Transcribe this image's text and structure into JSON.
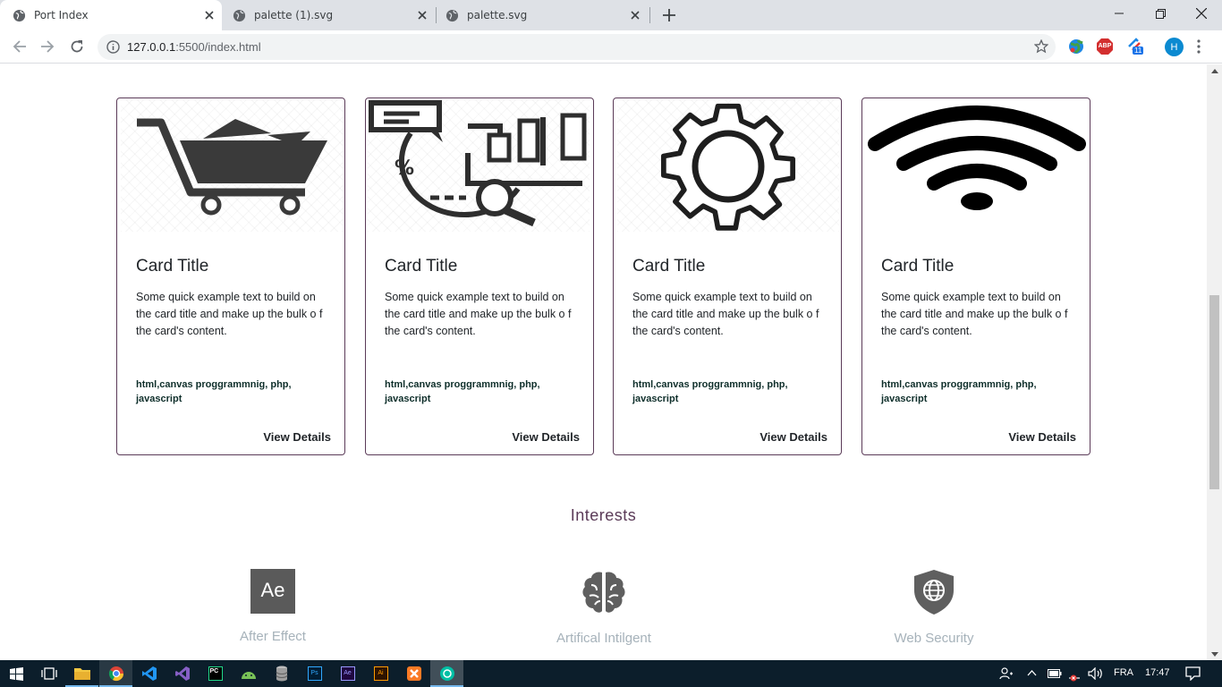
{
  "browser": {
    "tabs": [
      {
        "title": "Port Index",
        "active": true
      },
      {
        "title": "palette (1).svg",
        "active": false
      },
      {
        "title": "palette.svg",
        "active": false
      }
    ],
    "url_host": "127.0.0.1",
    "url_path": ":5500/index.html",
    "profile_initial": "H",
    "ext_badge": "11",
    "abp_label": "ABP"
  },
  "cards": [
    {
      "image_icon": "shopping-cart-icon",
      "title": "Card Title",
      "text": "Some quick example text to build on the card title and make up the bulk o f the card's content.",
      "tags": "html,canvas proggrammnig, php, javascript",
      "button": "View Details"
    },
    {
      "image_icon": "data-analysis-icon",
      "title": "Card Title",
      "text": "Some quick example text to build on the card title and make up the bulk o f the card's content.",
      "tags": "html,canvas proggrammnig, php, javascript",
      "button": "View Details"
    },
    {
      "image_icon": "gear-icon",
      "title": "Card Title",
      "text": "Some quick example text to build on the card title and make up the bulk o f the card's content.",
      "tags": "html,canvas proggrammnig, php, javascript",
      "button": "View Details"
    },
    {
      "image_icon": "wifi-icon",
      "title": "Card Title",
      "text": "Some quick example text to build on the card title and make up the bulk o f the card's content.",
      "tags": "html,canvas proggrammnig, php, javascript",
      "button": "View Details"
    }
  ],
  "interests": {
    "title": "Interests",
    "items": [
      {
        "icon": "after-effects-icon",
        "icon_text": "Ae",
        "label": "After Effect"
      },
      {
        "icon": "brain-icon",
        "label": "Artifical Intilgent"
      },
      {
        "icon": "web-security-shield-icon",
        "label": "Web Security"
      }
    ]
  },
  "taskbar": {
    "language": "FRA",
    "time": "17:47",
    "apps": [
      "file-explorer",
      "chrome",
      "vscode",
      "visual-studio",
      "pycharm",
      "android-studio",
      "database",
      "photoshop",
      "after-effects",
      "illustrator",
      "xampp",
      "chrome-app"
    ]
  },
  "colors": {
    "card_border": "#5b3b58",
    "interests_title": "#5b3b58",
    "interest_label": "#a6b2ba",
    "taskbar": "#0c1e2b"
  }
}
